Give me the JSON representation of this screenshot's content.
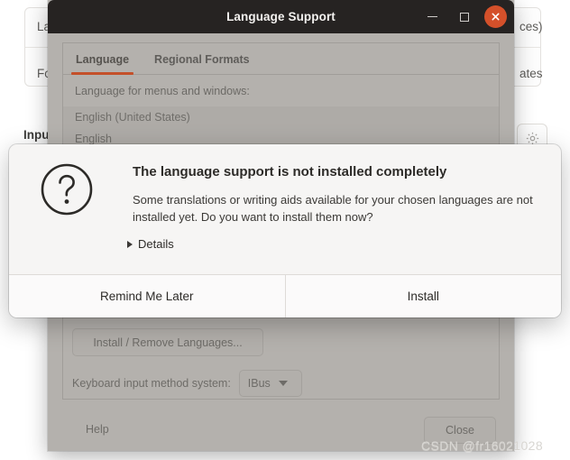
{
  "background_settings": {
    "row_language_left": "La",
    "row_language_right": "ces)",
    "row_format_left": "Fo",
    "row_format_right": "ates",
    "row_input_label": "Input",
    "gear_icon": "gear-icon"
  },
  "language_support_window": {
    "title": "Language Support",
    "titlebar_buttons": {
      "minimize": "minimize-icon",
      "maximize": "maximize-icon",
      "close": "close-icon"
    },
    "tabs": [
      {
        "label": "Language",
        "active": true
      },
      {
        "label": "Regional Formats",
        "active": false
      }
    ],
    "section_label": "Language for menus and windows:",
    "language_list": [
      "English (United States)",
      "English"
    ],
    "install_remove_button": "Install / Remove Languages...",
    "keyboard_input_label": "Keyboard input method system:",
    "keyboard_input_value": "IBus",
    "help_button": "Help",
    "close_button": "Close",
    "accent_color": "#c4502a",
    "titlebar_color": "#262322",
    "body_color": "#b4b1ad"
  },
  "dialog": {
    "icon": "question-mark-icon",
    "heading": "The language support is not installed completely",
    "message": "Some translations or writing aids available for your chosen languages are not installed yet. Do you want to install them now?",
    "details_label": "Details",
    "buttons": [
      {
        "label": "Remind Me Later"
      },
      {
        "label": "Install"
      }
    ]
  },
  "watermark": "CSDN @fr16021028"
}
